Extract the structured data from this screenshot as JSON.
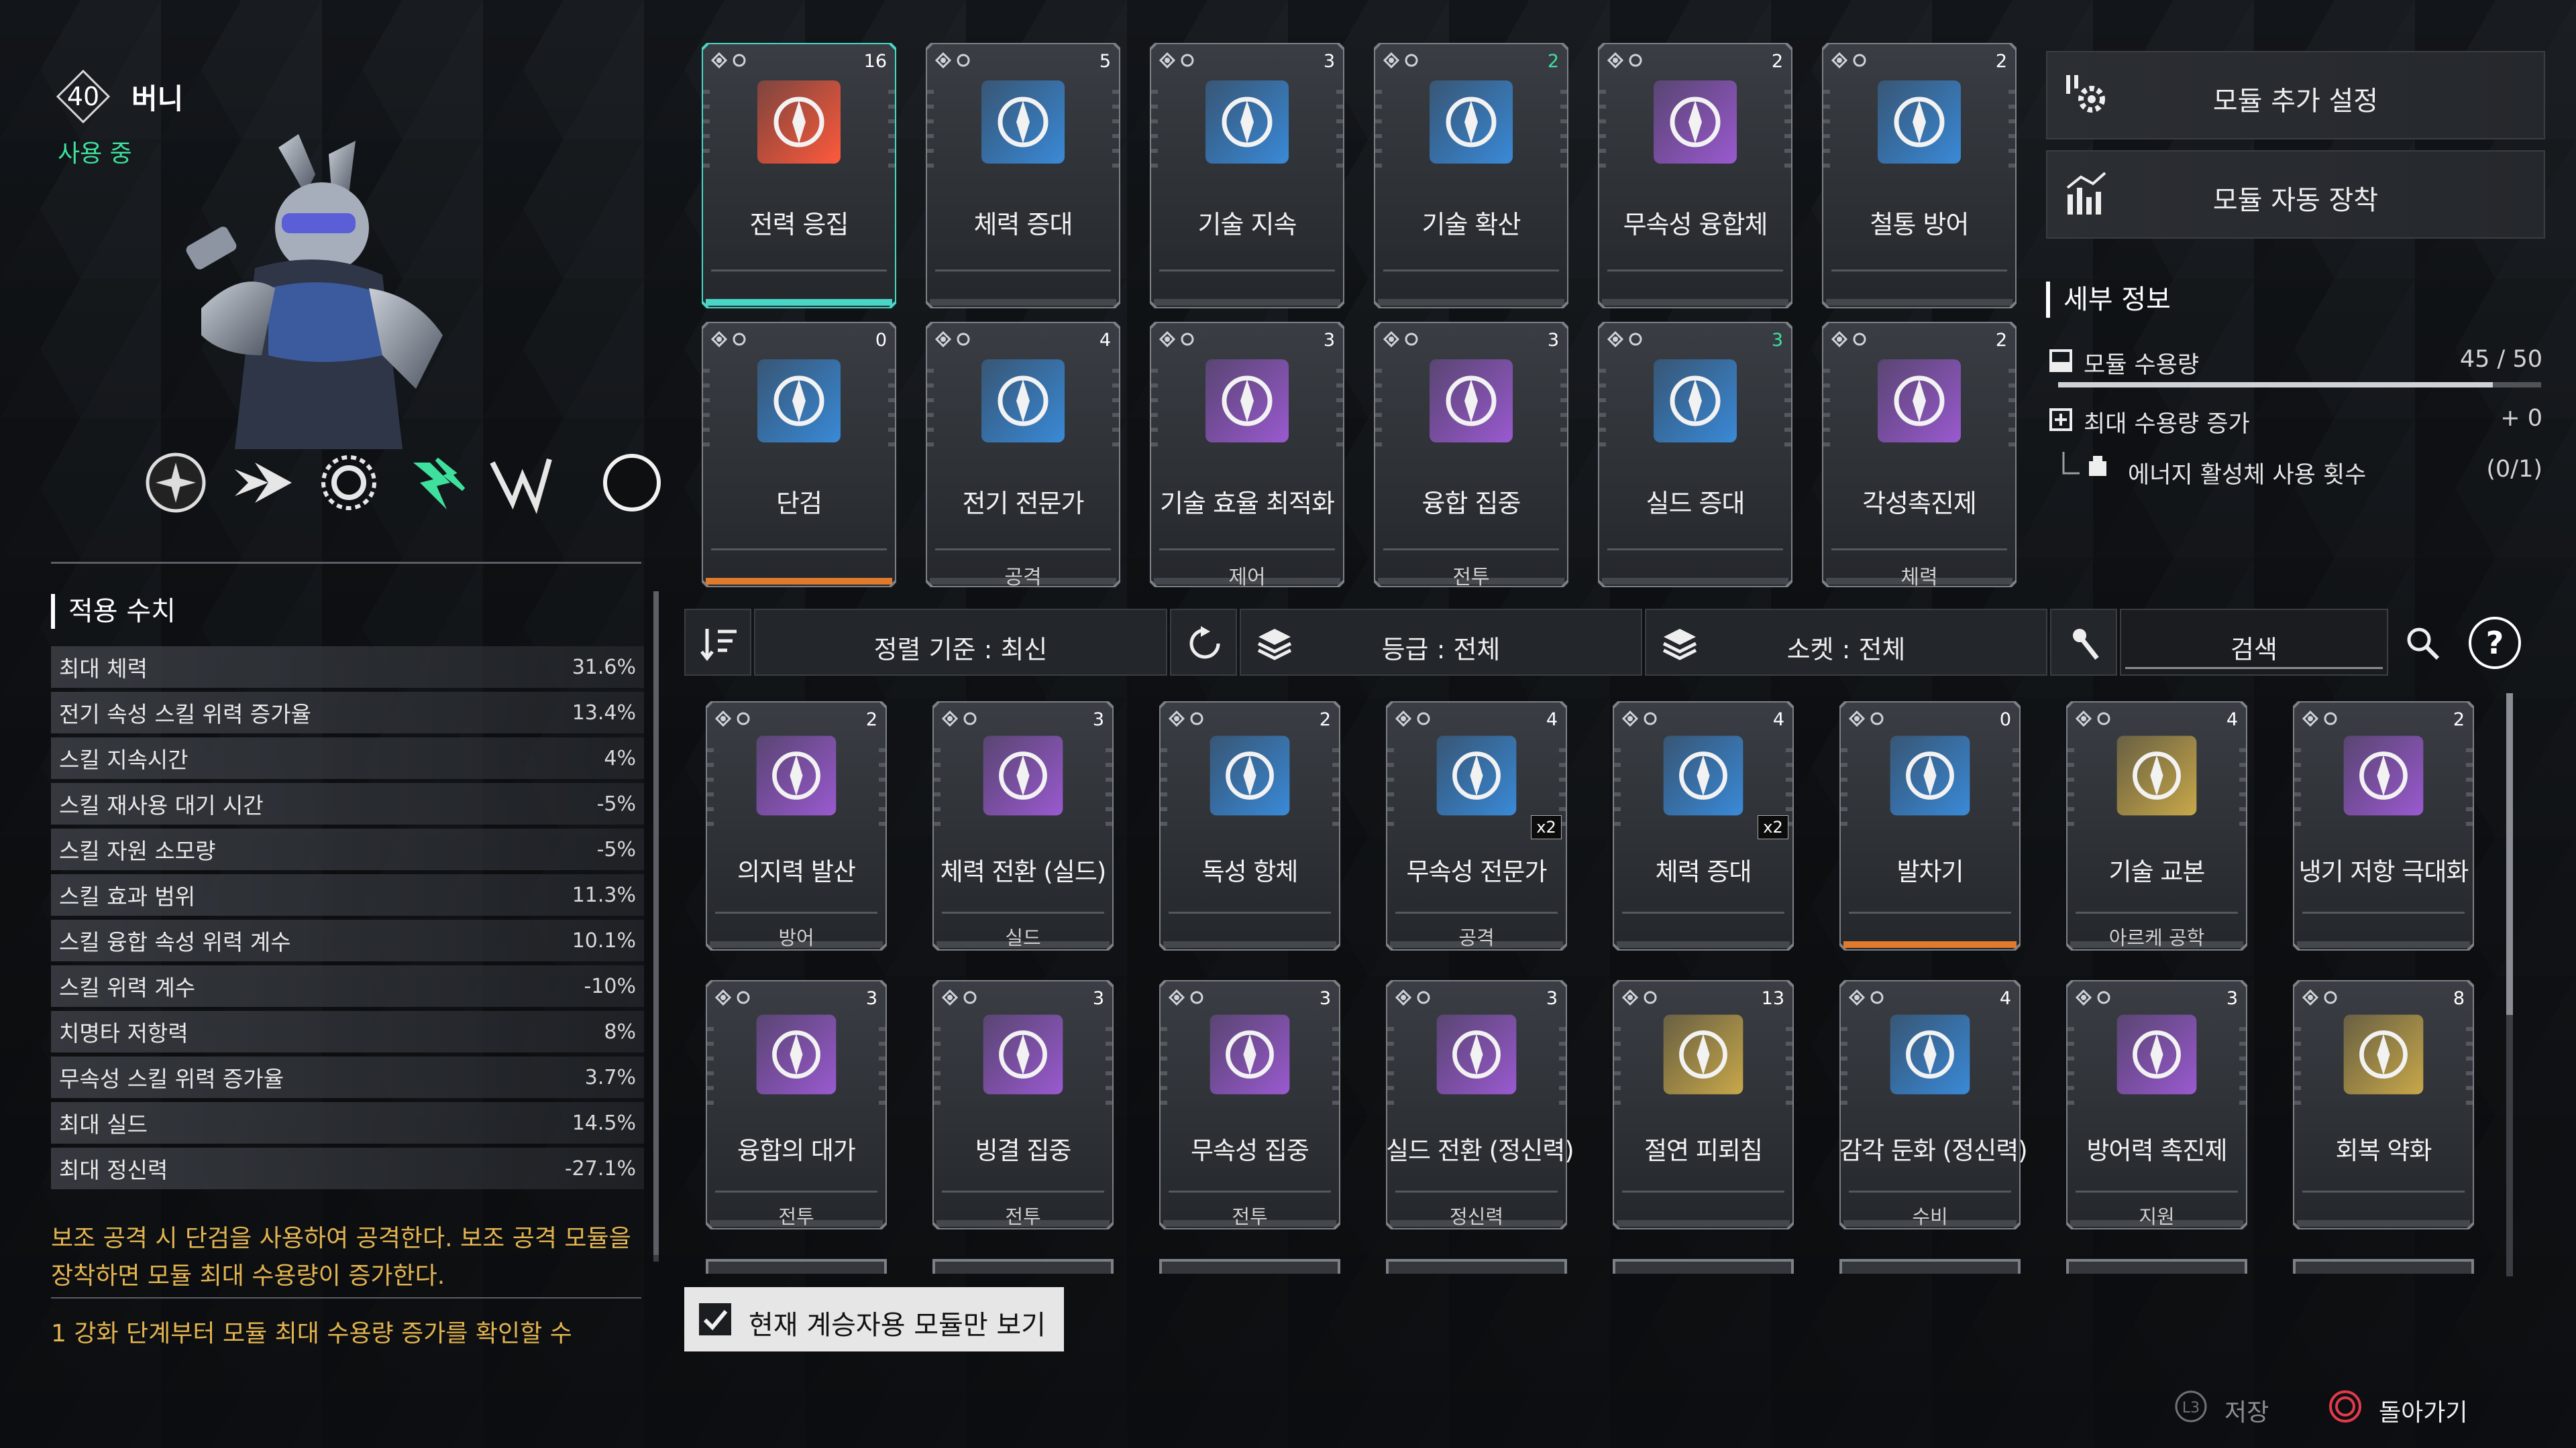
{
  "character": {
    "level": "40",
    "name": "버니",
    "status": "사용 중"
  },
  "skills": [
    "circle-compass-icon",
    "dash-arrow-icon",
    "sun-gear-icon",
    "lightning-active-icon",
    "double-lightning-icon",
    "ring-slot-icon"
  ],
  "stats": {
    "title": "적용 수치",
    "rows": [
      {
        "label": "최대 체력",
        "value": "31.6%"
      },
      {
        "label": "전기 속성 스킬 위력 증가율",
        "value": "13.4%"
      },
      {
        "label": "스킬 지속시간",
        "value": "4%"
      },
      {
        "label": "스킬 재사용 대기 시간",
        "value": "-5%"
      },
      {
        "label": "스킬 자원 소모량",
        "value": "-5%"
      },
      {
        "label": "스킬 효과 범위",
        "value": "11.3%"
      },
      {
        "label": "스킬 융합 속성 위력 계수",
        "value": "10.1%"
      },
      {
        "label": "스킬 위력 계수",
        "value": "-10%"
      },
      {
        "label": "치명타 저항력",
        "value": "8%"
      },
      {
        "label": "무속성 스킬 위력 증가율",
        "value": "3.7%"
      },
      {
        "label": "최대 실드",
        "value": "14.5%"
      },
      {
        "label": "최대 정신력",
        "value": "-27.1%"
      }
    ]
  },
  "description": {
    "line1": "보조 공격 시 단검을 사용하여 공격한다. 보조 공격 모듈을",
    "line2": "장착하면 모듈 최대 수용량이 증가한다.",
    "line3": "1 강화 단계부터 모듈 최대 수용량 증가를 확인할 수"
  },
  "equipped": [
    {
      "name": "전력 응집",
      "cost": "16",
      "category": "",
      "tier": "teal",
      "accent": "#ff5a3c",
      "cost_green": false
    },
    {
      "name": "체력 증대",
      "cost": "5",
      "category": "",
      "tier": "gray",
      "accent": "#3a8ad8",
      "cost_green": false
    },
    {
      "name": "기술 지속",
      "cost": "3",
      "category": "",
      "tier": "gray",
      "accent": "#3a8ad8",
      "cost_green": false
    },
    {
      "name": "기술 확산",
      "cost": "2",
      "category": "",
      "tier": "gray",
      "accent": "#3a8ad8",
      "cost_green": true
    },
    {
      "name": "무속성 융합체",
      "cost": "2",
      "category": "",
      "tier": "gray",
      "accent": "#9a5ad0",
      "cost_green": false
    },
    {
      "name": "철통 방어",
      "cost": "2",
      "category": "",
      "tier": "gray",
      "accent": "#3a8ad8",
      "cost_green": false
    },
    {
      "name": "단검",
      "cost": "0",
      "category": "",
      "tier": "orange",
      "accent": "#3a8ad8",
      "cost_green": false
    },
    {
      "name": "전기 전문가",
      "cost": "4",
      "category": "공격",
      "tier": "gray",
      "accent": "#3a8ad8",
      "cost_green": false
    },
    {
      "name": "기술 효율 최적화",
      "cost": "3",
      "category": "제어",
      "tier": "gray",
      "accent": "#9a5ad0",
      "cost_green": false
    },
    {
      "name": "융합 집중",
      "cost": "3",
      "category": "전투",
      "tier": "gray",
      "accent": "#9a5ad0",
      "cost_green": false
    },
    {
      "name": "실드 증대",
      "cost": "3",
      "category": "",
      "tier": "gray",
      "accent": "#3a8ad8",
      "cost_green": true
    },
    {
      "name": "각성촉진제",
      "cost": "2",
      "category": "체력",
      "tier": "gray",
      "accent": "#9a5ad0",
      "cost_green": false
    }
  ],
  "right_panel": {
    "btn_settings": "모듈 추가 설정",
    "btn_auto": "모듈 자동 장착",
    "detail_title": "세부 정보",
    "capacity_label": "모듈 수용량",
    "capacity_value": "45 / 50",
    "capacity_fraction": 0.9,
    "max_increase_label": "최대 수용량 증가",
    "max_increase_value": "+ 0",
    "energy_label": "에너지 활성체 사용 횟수",
    "energy_value": "(0/1)"
  },
  "filters": {
    "sort": "정렬 기준 : 최신",
    "grade": "등급 : 전체",
    "socket": "소켓 : 전체",
    "search_placeholder": "검색",
    "help": "?"
  },
  "inventory": [
    {
      "name": "의지력 발산",
      "cost": "2",
      "category": "방어",
      "tier": "gray",
      "accent": "#9a5ad0",
      "x2": false
    },
    {
      "name": "체력 전환 (실드)",
      "cost": "3",
      "category": "실드",
      "tier": "gray",
      "accent": "#9a5ad0",
      "x2": false
    },
    {
      "name": "독성 항체",
      "cost": "2",
      "category": "",
      "tier": "gray",
      "accent": "#3a8ad8",
      "x2": false
    },
    {
      "name": "무속성 전문가",
      "cost": "4",
      "category": "공격",
      "tier": "gray",
      "accent": "#3a8ad8",
      "x2": true
    },
    {
      "name": "체력 증대",
      "cost": "4",
      "category": "",
      "tier": "gray",
      "accent": "#3a8ad8",
      "x2": true
    },
    {
      "name": "발차기",
      "cost": "0",
      "category": "",
      "tier": "orange",
      "accent": "#3a8ad8",
      "x2": false
    },
    {
      "name": "기술 교본",
      "cost": "4",
      "category": "아르케 공학",
      "tier": "gray",
      "accent": "#c8a84a",
      "x2": false
    },
    {
      "name": "냉기 저항 극대화",
      "cost": "2",
      "category": "",
      "tier": "gray",
      "accent": "#9a5ad0",
      "x2": false
    },
    {
      "name": "융합의 대가",
      "cost": "3",
      "category": "전투",
      "tier": "gray",
      "accent": "#9a5ad0",
      "x2": false
    },
    {
      "name": "빙결 집중",
      "cost": "3",
      "category": "전투",
      "tier": "gray",
      "accent": "#9a5ad0",
      "x2": false
    },
    {
      "name": "무속성 집중",
      "cost": "3",
      "category": "전투",
      "tier": "gray",
      "accent": "#9a5ad0",
      "x2": false
    },
    {
      "name": "실드 전환 (정신력)",
      "cost": "3",
      "category": "정신력",
      "tier": "gray",
      "accent": "#9a5ad0",
      "x2": false
    },
    {
      "name": "절연 피뢰침",
      "cost": "13",
      "category": "",
      "tier": "gray",
      "accent": "#c8a84a",
      "x2": false
    },
    {
      "name": "감각 둔화 (정신력)",
      "cost": "4",
      "category": "수비",
      "tier": "gray",
      "accent": "#3a8ad8",
      "x2": false
    },
    {
      "name": "방어력 촉진제",
      "cost": "3",
      "category": "지원",
      "tier": "gray",
      "accent": "#9a5ad0",
      "x2": false
    },
    {
      "name": "회복 약화",
      "cost": "8",
      "category": "",
      "tier": "gray",
      "accent": "#c8a84a",
      "x2": false
    }
  ],
  "checkbox": {
    "label": "현재 계승자용 모듈만 보기",
    "checked": true
  },
  "footer": {
    "save": "저장",
    "back": "돌아가기"
  }
}
